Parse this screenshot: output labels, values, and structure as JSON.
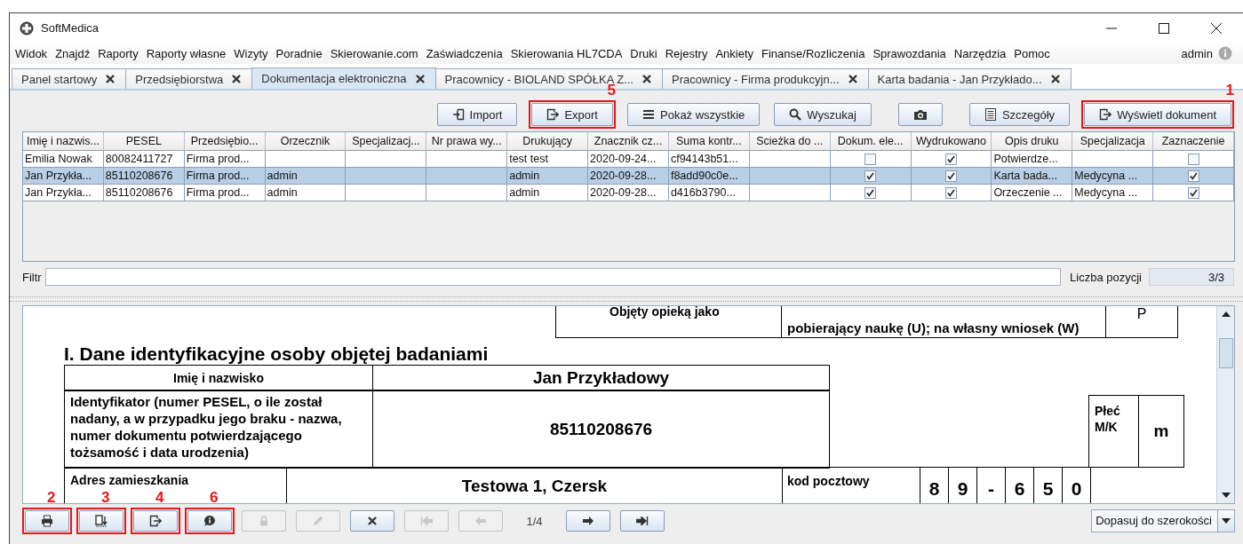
{
  "window": {
    "title": "SoftMedica"
  },
  "menu": [
    "Widok",
    "Znajdź",
    "Raporty",
    "Raporty własne",
    "Wizyty",
    "Poradnie",
    "Skierowanie.com",
    "Zaświadczenia",
    "Skierowania HL7CDA",
    "Druki",
    "Rejestry",
    "Ankiety",
    "Finanse/Rozliczenia",
    "Sprawozdania",
    "Narzędzia",
    "Pomoc"
  ],
  "user": "admin",
  "tabs": [
    {
      "label": "Panel startowy",
      "selected": false
    },
    {
      "label": "Przedsiębiorstwa",
      "selected": false
    },
    {
      "label": "Dokumentacja elektroniczna",
      "selected": true
    },
    {
      "label": "Pracownicy - BIOLAND SPÓŁKA Z...",
      "selected": false
    },
    {
      "label": "Pracownicy - Firma produkcyjn...",
      "selected": false
    },
    {
      "label": "Karta badania - Jan Przykłado...",
      "selected": false
    }
  ],
  "toolbar": [
    {
      "kind": "import",
      "label": "Import"
    },
    {
      "kind": "export",
      "label": "Export",
      "callout": "5"
    },
    {
      "kind": "list",
      "label": "Pokaż wszystkie"
    },
    {
      "kind": "search",
      "label": "Wyszukaj"
    },
    {
      "kind": "camera"
    },
    {
      "kind": "details",
      "label": "Szczegóły"
    },
    {
      "kind": "export",
      "label": "Wyświetl dokument",
      "callout": "1"
    }
  ],
  "table": {
    "columns": [
      "Imię i nazwis...",
      "PESEL",
      "Przedsiębio...",
      "Orzecznik",
      "Specjalizacj...",
      "Nr prawa wy...",
      "Drukujący",
      "Znacznik cz...",
      "Suma kontr...",
      "Scieżka do ...",
      "Dokum. ele...",
      "Wydrukowano",
      "Opis druku",
      "Specjalizacja",
      "Zaznaczenie"
    ],
    "rows": [
      {
        "selected": false,
        "cells": [
          {
            "kind": "text",
            "text": "Emilia Nowak"
          },
          {
            "kind": "text",
            "text": "80082411727"
          },
          {
            "kind": "text",
            "text": "Firma prod..."
          },
          {
            "kind": "empty"
          },
          {
            "kind": "empty"
          },
          {
            "kind": "empty"
          },
          {
            "kind": "text",
            "text": "test test"
          },
          {
            "kind": "text",
            "text": "2020-09-24..."
          },
          {
            "kind": "text",
            "text": "cf94143b51..."
          },
          {
            "kind": "empty"
          },
          {
            "kind": "check",
            "checked": false
          },
          {
            "kind": "check",
            "checked": true
          },
          {
            "kind": "text",
            "text": "Potwierdze..."
          },
          {
            "kind": "empty"
          },
          {
            "kind": "check",
            "checked": false
          }
        ]
      },
      {
        "selected": true,
        "cells": [
          {
            "kind": "text",
            "text": "Jan Przykła..."
          },
          {
            "kind": "text",
            "text": "85110208676"
          },
          {
            "kind": "text",
            "text": "Firma prod..."
          },
          {
            "kind": "text",
            "text": "admin"
          },
          {
            "kind": "empty"
          },
          {
            "kind": "empty"
          },
          {
            "kind": "text",
            "text": "admin"
          },
          {
            "kind": "text",
            "text": "2020-09-28..."
          },
          {
            "kind": "text",
            "text": "f8add90c0e..."
          },
          {
            "kind": "empty"
          },
          {
            "kind": "check",
            "checked": true
          },
          {
            "kind": "check",
            "checked": true
          },
          {
            "kind": "text",
            "text": "Karta bada..."
          },
          {
            "kind": "text",
            "text": "Medycyna ..."
          },
          {
            "kind": "check",
            "checked": true
          }
        ]
      },
      {
        "selected": false,
        "cells": [
          {
            "kind": "text",
            "text": "Jan Przykła..."
          },
          {
            "kind": "text",
            "text": "85110208676"
          },
          {
            "kind": "text",
            "text": "Firma prod..."
          },
          {
            "kind": "text",
            "text": "admin"
          },
          {
            "kind": "empty"
          },
          {
            "kind": "empty"
          },
          {
            "kind": "text",
            "text": "admin"
          },
          {
            "kind": "text",
            "text": "2020-09-28..."
          },
          {
            "kind": "text",
            "text": "d416b3790..."
          },
          {
            "kind": "empty"
          },
          {
            "kind": "check",
            "checked": true
          },
          {
            "kind": "check",
            "checked": true
          },
          {
            "kind": "text",
            "text": "Orzeczenie ..."
          },
          {
            "kind": "text",
            "text": "Medycyna ..."
          },
          {
            "kind": "check",
            "checked": true
          }
        ]
      }
    ]
  },
  "filter": {
    "label": "Filtr"
  },
  "count": {
    "label": "Liczba pozycji",
    "value": "3/3"
  },
  "document": {
    "care_label": "Objęty opieką jako",
    "care_text": "pobierający naukę (U); na własny wniosek (W)",
    "care_value": "P",
    "heading": "I. Dane identyfikacyjne osoby objętej badaniami",
    "name_label": "Imię i nazwisko",
    "name_value": "Jan Przykładowy",
    "id_label": "Identyfikator (numer PESEL, o ile został nadany, a w przypadku jego braku - nazwa, numer dokumentu potwierdzającego tożsamość i data urodzenia)",
    "id_value": "85110208676",
    "sex_label": "Płeć M/K",
    "sex_value": "m",
    "address_label": "Adres zamieszkania",
    "address_value": "Testowa 1, Czersk",
    "postal_label": "kod pocztowy",
    "postal_digits": [
      "8",
      "9",
      "-",
      "6",
      "5",
      "0"
    ]
  },
  "bottom_toolbar": [
    {
      "kind": "print",
      "disabled": false,
      "callout": "2"
    },
    {
      "kind": "doc-down",
      "disabled": false,
      "callout": "3"
    },
    {
      "kind": "export",
      "disabled": false,
      "callout": "4"
    },
    {
      "kind": "info",
      "disabled": false,
      "callout": "6"
    },
    {
      "kind": "lock",
      "disabled": true
    },
    {
      "kind": "pencil",
      "disabled": true
    },
    {
      "kind": "delete",
      "disabled": false
    },
    {
      "kind": "first",
      "disabled": true
    },
    {
      "kind": "prev",
      "disabled": true
    },
    {
      "kind": "page",
      "label": "1/4"
    },
    {
      "kind": "next",
      "disabled": false
    },
    {
      "kind": "last",
      "disabled": false
    }
  ],
  "zoom": {
    "value": "Dopasuj do szerokości"
  }
}
